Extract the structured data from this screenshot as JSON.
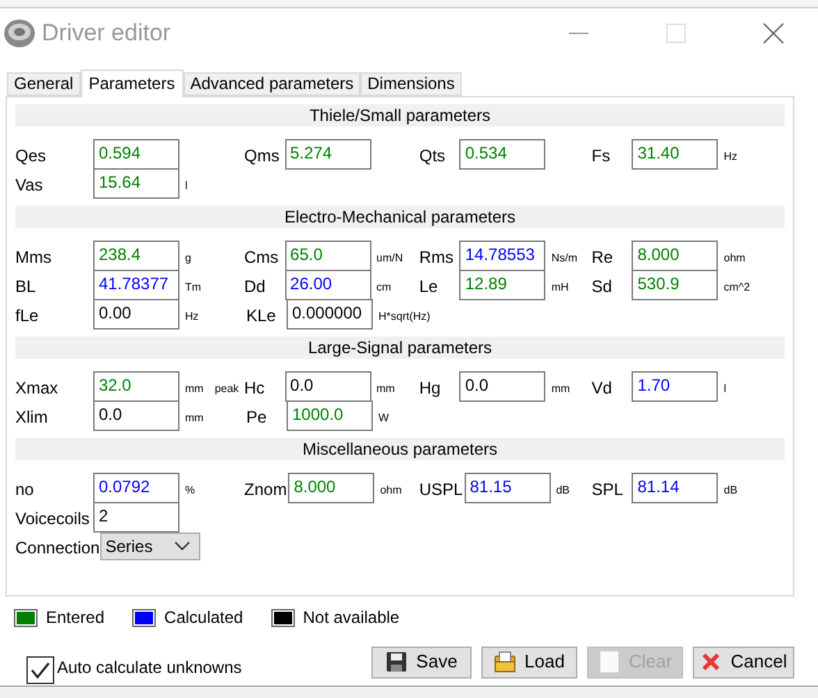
{
  "window": {
    "title": "Driver editor"
  },
  "tabs": [
    {
      "label": "General",
      "selected": false
    },
    {
      "label": "Parameters",
      "selected": true
    },
    {
      "label": "Advanced parameters",
      "selected": false
    },
    {
      "label": "Dimensions",
      "selected": false
    }
  ],
  "sections": [
    {
      "title": "Thiele/Small parameters",
      "rows": [
        [
          {
            "kind": "field",
            "label": "Qes",
            "value": "0.594",
            "color": "#008000"
          },
          {
            "kind": "field",
            "label": "Qms",
            "value": "5.274",
            "color": "#008000"
          },
          {
            "kind": "field",
            "label": "Qts",
            "value": "0.534",
            "color": "#008000"
          },
          {
            "kind": "field",
            "label": "Fs",
            "value": "31.40",
            "unit": "Hz",
            "color": "#008000"
          }
        ],
        [
          {
            "kind": "field",
            "label": "Vas",
            "value": "15.64",
            "unit": "l",
            "color": "#008000"
          }
        ]
      ]
    },
    {
      "title": "Electro-Mechanical parameters",
      "rows": [
        [
          {
            "kind": "field",
            "label": "Mms",
            "value": "238.4",
            "unit": "g",
            "color": "#008000"
          },
          {
            "kind": "field",
            "label": "Cms",
            "value": "65.0",
            "unit": "um/N",
            "color": "#008000"
          },
          {
            "kind": "field",
            "label": "Rms",
            "value": "14.78553",
            "unit": "Ns/m",
            "color": "#0000ff"
          },
          {
            "kind": "field",
            "label": "Re",
            "value": "8.000",
            "unit": "ohm",
            "color": "#008000"
          }
        ],
        [
          {
            "kind": "field",
            "label": "BL",
            "value": "41.78377",
            "unit": "Tm",
            "color": "#0000ff"
          },
          {
            "kind": "field",
            "label": "Dd",
            "value": "26.00",
            "unit": "cm",
            "color": "#0000ff"
          },
          {
            "kind": "field",
            "label": "Le",
            "value": "12.89",
            "unit": "mH",
            "color": "#008000"
          },
          {
            "kind": "field",
            "label": "Sd",
            "value": "530.9",
            "unit": "cm^2",
            "color": "#008000"
          }
        ],
        [
          {
            "kind": "field",
            "label": "fLe",
            "value": "0.00",
            "unit": "Hz",
            "color": "#000000"
          },
          {
            "kind": "field",
            "label": "KLe",
            "value": "0.000000",
            "unit": "H*sqrt(Hz)",
            "color": "#000000"
          }
        ]
      ]
    },
    {
      "title": "Large-Signal parameters",
      "rows": [
        [
          {
            "kind": "field",
            "label": "Xmax",
            "value": "32.0",
            "unit": "mm",
            "note": "peak",
            "color": "#008000"
          },
          {
            "kind": "field",
            "label": "Hc",
            "value": "0.0",
            "unit": "mm",
            "color": "#000000"
          },
          {
            "kind": "field",
            "label": "Hg",
            "value": "0.0",
            "unit": "mm",
            "color": "#000000"
          },
          {
            "kind": "field",
            "label": "Vd",
            "value": "1.70",
            "unit": "l",
            "color": "#0000ff"
          }
        ],
        [
          {
            "kind": "field",
            "label": "Xlim",
            "value": "0.0",
            "unit": "mm",
            "color": "#000000"
          },
          {
            "kind": "field",
            "label": "Pe",
            "value": "1000.0",
            "unit": "W",
            "color": "#008000"
          }
        ]
      ]
    },
    {
      "title": "Miscellaneous parameters",
      "rows": [
        [
          {
            "kind": "field",
            "label": "no",
            "value": "0.0792",
            "unit": "%",
            "color": "#0000ff"
          },
          {
            "kind": "field",
            "label": "Znom",
            "value": "8.000",
            "unit": "ohm",
            "color": "#008000"
          },
          {
            "kind": "field",
            "label": "USPL",
            "value": "81.15",
            "unit": "dB",
            "color": "#0000ff"
          },
          {
            "kind": "field",
            "label": "SPL",
            "value": "81.14",
            "unit": "dB",
            "color": "#0000ff"
          }
        ],
        [
          {
            "kind": "field",
            "label": "Voicecoils",
            "value": "2",
            "color": "#000000"
          }
        ],
        [
          {
            "kind": "dropdown",
            "label": "Connection",
            "value": "Series"
          }
        ]
      ]
    }
  ],
  "legend": [
    {
      "label": "Entered",
      "color": "#008000"
    },
    {
      "label": "Calculated",
      "color": "#0000ff"
    },
    {
      "label": "Not available",
      "color": "#000000"
    }
  ],
  "auto_calculate": {
    "label": "Auto calculate unknowns",
    "checked": true
  },
  "buttons": [
    {
      "kind": "save",
      "label": "Save",
      "disabled": false
    },
    {
      "kind": "load",
      "label": "Load",
      "disabled": false
    },
    {
      "kind": "clear",
      "label": "Clear",
      "disabled": true
    },
    {
      "kind": "cancel",
      "label": "Cancel",
      "disabled": false
    }
  ]
}
